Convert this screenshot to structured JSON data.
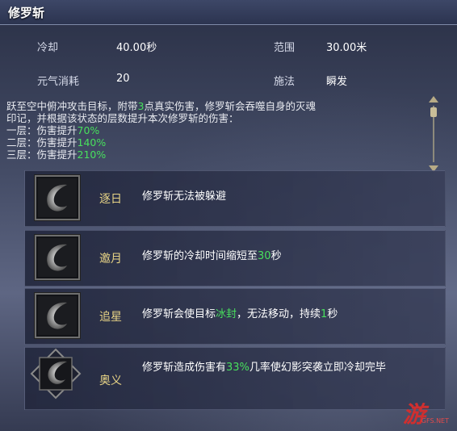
{
  "window": {
    "title": "修罗斩"
  },
  "stats": {
    "cooldown_label": "冷却",
    "cooldown_value": "40.00秒",
    "range_label": "范围",
    "range_value": "30.00米",
    "cost_label": "元气消耗",
    "cost_value": "20",
    "cast_label": "施法",
    "cast_value": "瞬发"
  },
  "description": {
    "line1_a": "跃至空中俯冲攻击目标，附带",
    "line1_num": "3",
    "line1_b": "点真实伤害，修罗斩会吞噬自身的灭魂",
    "line2": "印记，并根据该状态的层数提升本次修罗斩的伤害：",
    "line3_a": "一层：伤害提升",
    "line3_num": "70%",
    "line4_a": "二层：伤害提升",
    "line4_num": "140%",
    "line5_a": "三层：伤害提升",
    "line5_num": "210%"
  },
  "talents": [
    {
      "name": "逐日",
      "desc": "修罗斩无法被躲避"
    },
    {
      "name": "邀月",
      "desc_a": "修罗斩的冷却时间缩短至",
      "desc_num": "30",
      "desc_b": "秒"
    },
    {
      "name": "追星",
      "desc_a": "修罗斩会使目标",
      "desc_hl": "冰封",
      "desc_b": "，无法移动，持续",
      "desc_num": "1",
      "desc_c": "秒"
    },
    {
      "name": "奥义",
      "desc_a": "修罗斩造成伤害有",
      "desc_num": "33%",
      "desc_b": "几率使幻影突袭立即冷却完毕"
    }
  ],
  "watermark": {
    "text": "游",
    "sub": "GFS.NET"
  },
  "colors": {
    "highlight": "#48e05d",
    "talent_name": "#e9d586"
  }
}
